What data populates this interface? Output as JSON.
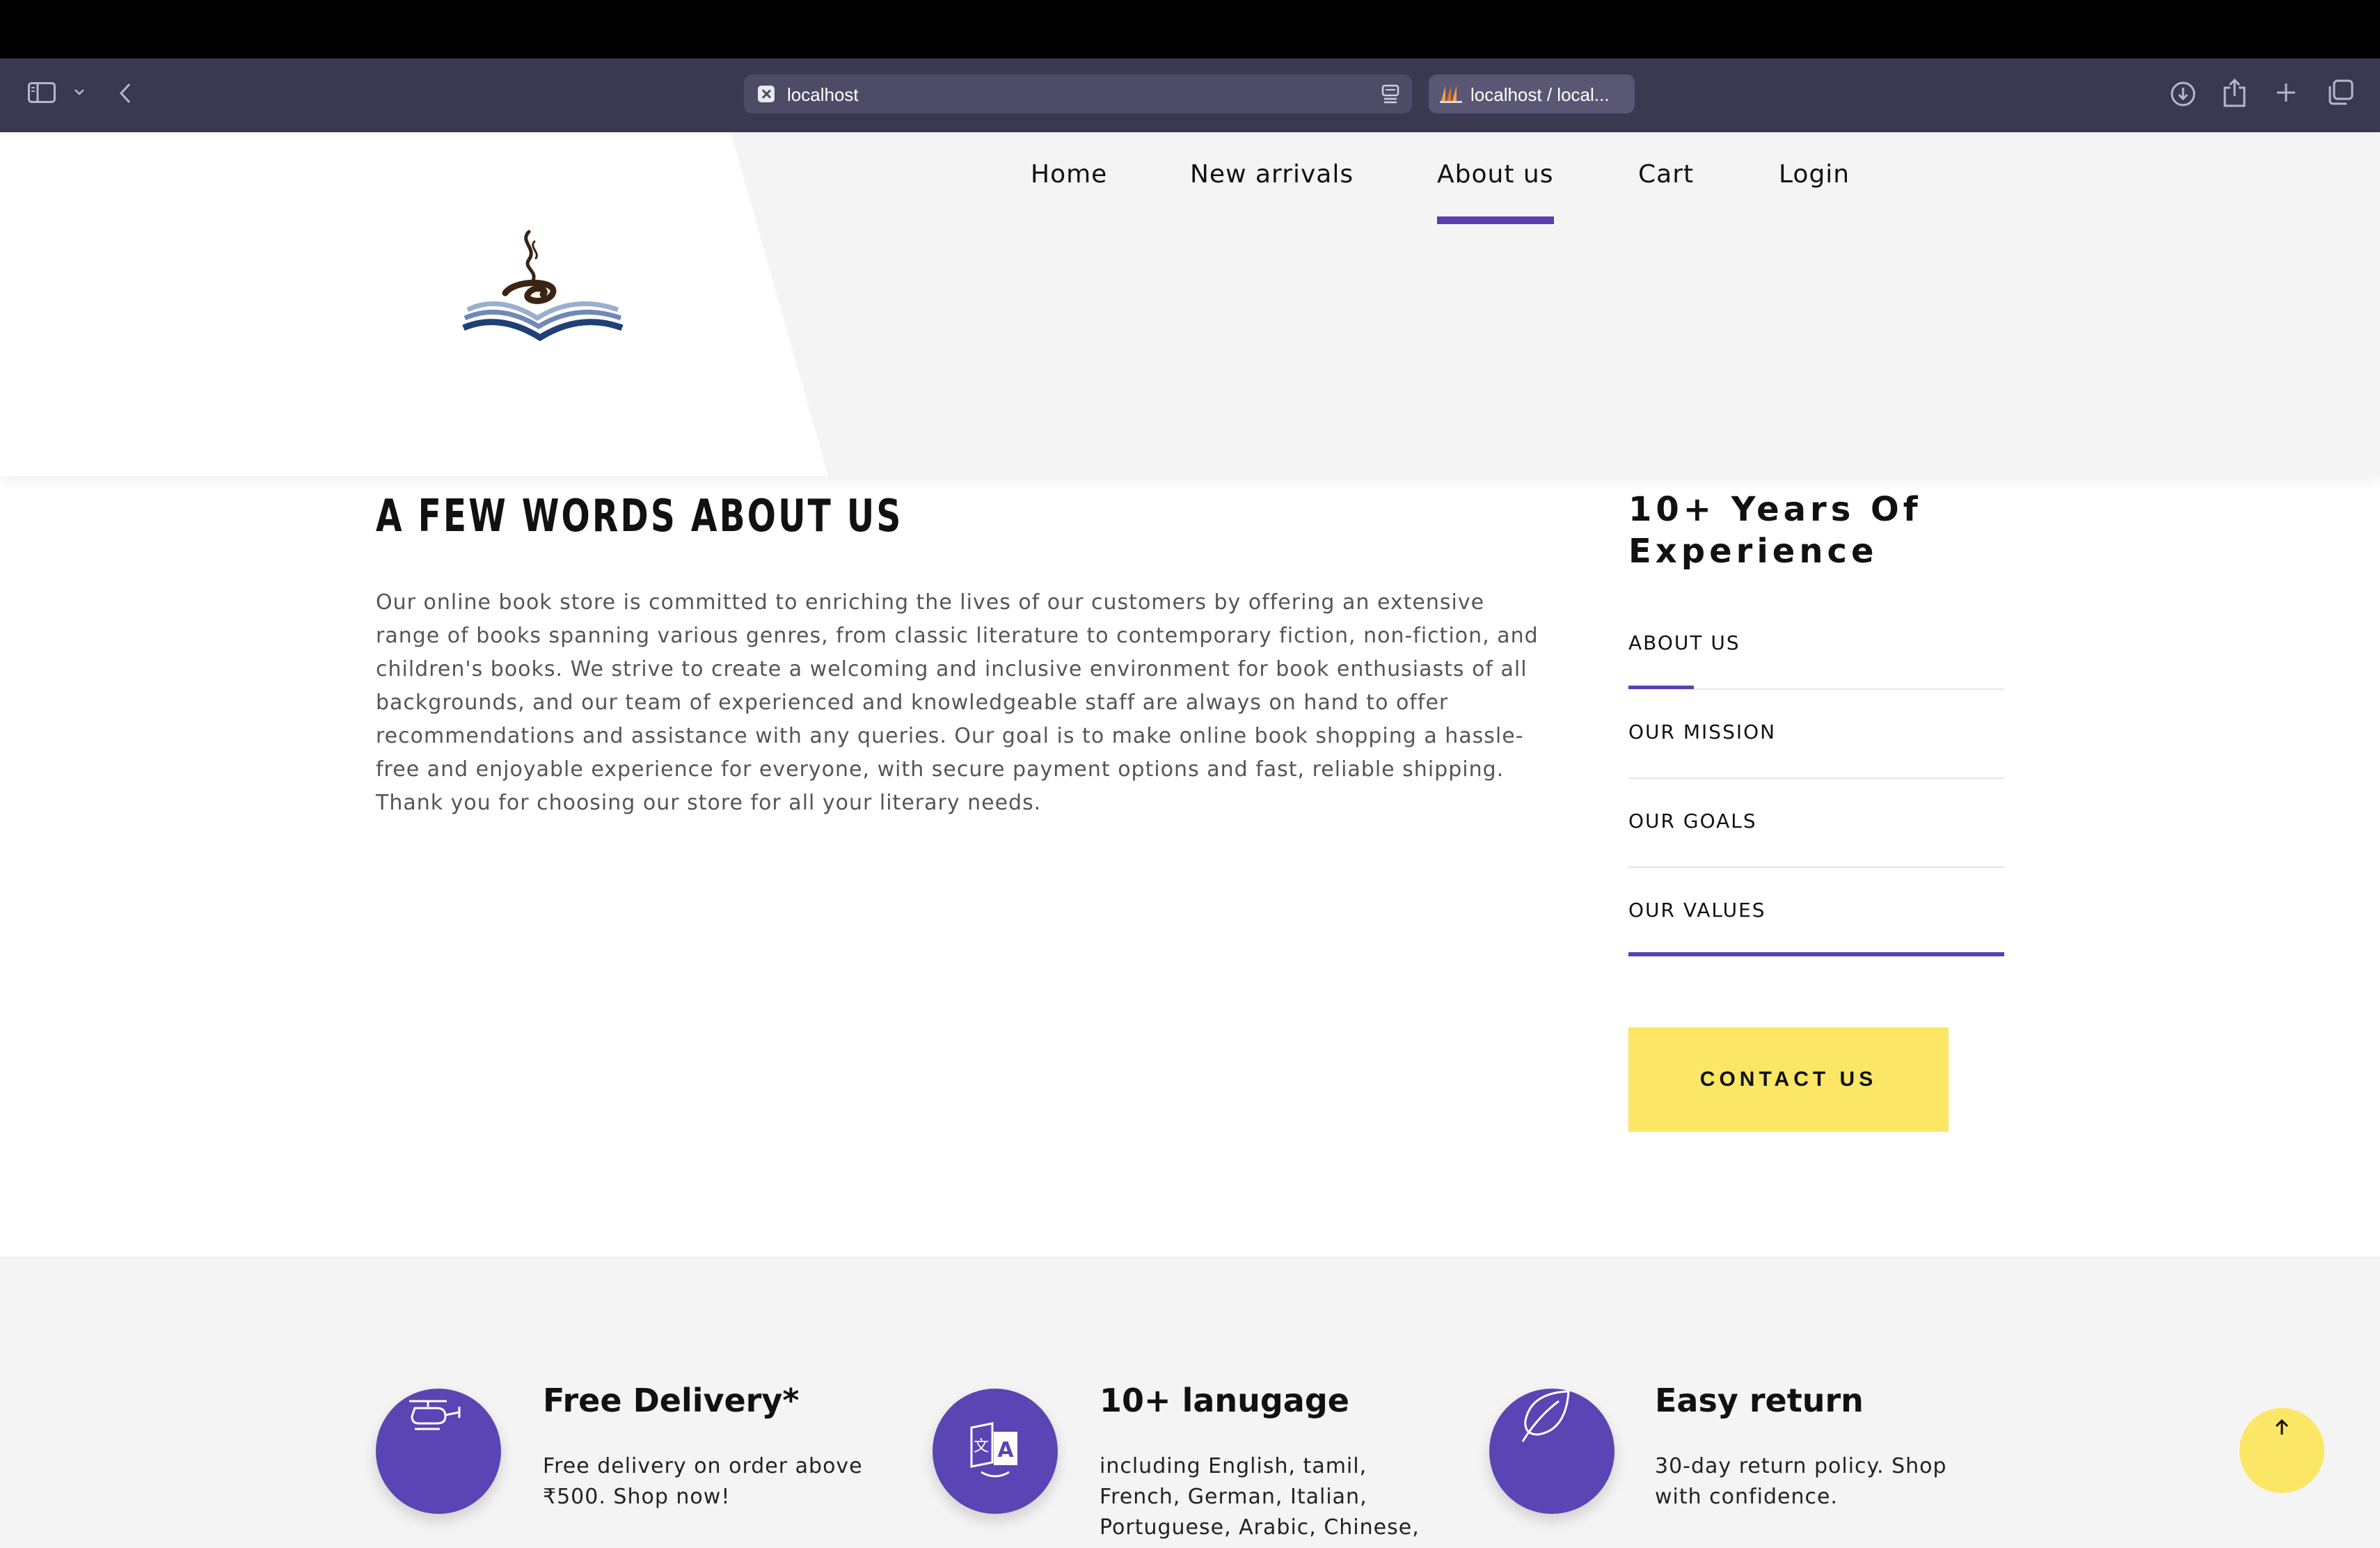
{
  "browser": {
    "url": "localhost",
    "second_tab_title": "localhost / local...",
    "icons": [
      "sidebar-icon",
      "chevron-down-icon",
      "back-icon",
      "reader-icon",
      "download-icon",
      "share-icon",
      "plus-icon",
      "tabs-icon"
    ]
  },
  "nav": {
    "items": [
      "Home",
      "New arrivals",
      "About us",
      "Cart",
      "Login"
    ],
    "active": "About us",
    "accent_color": "#5a3fb0"
  },
  "about": {
    "heading": "A FEW WORDS ABOUT US",
    "text": "Our online book store is committed to enriching the lives of our customers by offering an extensive range of books spanning various genres, from classic literature to contemporary fiction, non-fiction, and children's books. We strive to create a welcoming and inclusive environment for book enthusiasts of all backgrounds, and our team of experienced and knowledgeable staff are always on hand to offer recommendations and assistance with any queries. Our goal is to make online book shopping a hassle-free and enjoyable experience for everyone, with secure payment options and fast, reliable shipping. Thank you for choosing our store for all your literary needs."
  },
  "sidebar": {
    "years": "10+ Years Of Experience",
    "items": [
      "ABOUT US",
      "OUR MISSION",
      "OUR GOALS",
      "OUR VALUES"
    ],
    "active": "ABOUT US",
    "contact_label": "CONTACT US",
    "contact_color": "#fbe765"
  },
  "features": [
    {
      "title": "Free Delivery*",
      "desc": "Free delivery on order above ₹500. Shop now!",
      "icon": "helicopter-icon"
    },
    {
      "title": "10+ lanugage",
      "desc": "including English, tamil, French, German, Italian, Portuguese, Arabic, Chinese,",
      "icon": "translate-icon"
    },
    {
      "title": "Easy return",
      "desc": "30-day return policy. Shop with confidence.",
      "icon": "leaf-icon"
    }
  ],
  "feature_circle_color": "#5b44b3"
}
